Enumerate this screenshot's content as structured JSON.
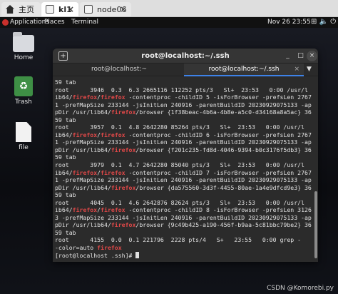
{
  "browser_tabs": [
    {
      "label": "主页",
      "icon": "home-icon"
    },
    {
      "label": "kl1",
      "icon": "vm-icon"
    },
    {
      "label": "node06",
      "icon": "vm-icon"
    }
  ],
  "topbar": {
    "applications": "Applications",
    "places": "Places",
    "terminal": "Terminal",
    "clock": "Nov 26  23:55",
    "status": "⊞ 🔈 ⏻"
  },
  "desktop_icons": [
    {
      "label": "Home",
      "icon": "folder-icon"
    },
    {
      "label": "Trash",
      "icon": "trash-icon"
    },
    {
      "label": "file",
      "icon": "file-icon"
    }
  ],
  "terminal": {
    "title": "root@localhost:~/.ssh",
    "tabs": [
      {
        "label": "root@localhost:~"
      },
      {
        "label": "root@localhost:~/.ssh"
      }
    ],
    "highlight_color": "#e04848",
    "lines": [
      [
        [
          "59 tab",
          ""
        ]
      ],
      [
        [
          "root      3946  0.3  6.3 2665116 112252 pts/3   Sl+  23:53   0:00 /usr/l",
          ""
        ]
      ],
      [
        [
          "ib64/",
          ""
        ],
        [
          "firefox",
          "hl"
        ],
        [
          "/",
          ""
        ],
        [
          "firefox",
          "hl"
        ],
        [
          " -contentproc -childID 5 -isForBrowser -prefsLen 2767",
          ""
        ]
      ],
      [
        [
          "1 -prefMapSize 233144 -jsInitLen 240916 -parentBuildID 20230929075133 -ap",
          ""
        ]
      ],
      [
        [
          "pDir /usr/lib64/",
          ""
        ],
        [
          "firefox",
          "hl"
        ],
        [
          "/browser {1f38beac-4b6a-4b8e-a5c0-d34168a8a5ac} 36",
          ""
        ]
      ],
      [
        [
          "59 tab",
          ""
        ]
      ],
      [
        [
          "root      3957  0.1  4.8 2642280 85264 pts/3   Sl+  23:53   0:00 /usr/l",
          ""
        ]
      ],
      [
        [
          "ib64/",
          ""
        ],
        [
          "firefox",
          "hl"
        ],
        [
          "/",
          ""
        ],
        [
          "firefox",
          "hl"
        ],
        [
          " -contentproc -childID 6 -isForBrowser -prefsLen 2767",
          ""
        ]
      ],
      [
        [
          "1 -prefMapSize 233144 -jsInitLen 240916 -parentBuildID 20230929075133 -ap",
          ""
        ]
      ],
      [
        [
          "pDir /usr/lib64/",
          ""
        ],
        [
          "firefox",
          "hl"
        ],
        [
          "/browser {f201c235-fd8d-4046-9394-b0c3176f5db3} 36",
          ""
        ]
      ],
      [
        [
          "59 tab",
          ""
        ]
      ],
      [
        [
          "root      3979  0.1  4.7 2642280 85040 pts/3   Sl+  23:53   0:00 /usr/l",
          ""
        ]
      ],
      [
        [
          "ib64/",
          ""
        ],
        [
          "firefox",
          "hl"
        ],
        [
          "/",
          ""
        ],
        [
          "firefox",
          "hl"
        ],
        [
          " -contentproc -childID 7 -isForBrowser -prefsLen 2767",
          ""
        ]
      ],
      [
        [
          "1 -prefMapSize 233144 -jsInitLen 240916 -parentBuildID 20230929075133 -ap",
          ""
        ]
      ],
      [
        [
          "pDir /usr/lib64/",
          ""
        ],
        [
          "firefox",
          "hl"
        ],
        [
          "/browser {da575560-3d3f-4455-80ae-1a4e9dfcd9e3} 36",
          ""
        ]
      ],
      [
        [
          "59 tab",
          ""
        ]
      ],
      [
        [
          "root      4045  0.1  4.6 2642876 82624 pts/3   Sl+  23:53   0:00 /usr/l",
          ""
        ]
      ],
      [
        [
          "ib64/",
          ""
        ],
        [
          "firefox",
          "hl"
        ],
        [
          "/",
          ""
        ],
        [
          "firefox",
          "hl"
        ],
        [
          " -contentproc -childID 8 -isForBrowser -prefsLen 3126",
          ""
        ]
      ],
      [
        [
          "3 -prefMapSize 233144 -jsInitLen 240916 -parentBuildID 20230929075133 -ap",
          ""
        ]
      ],
      [
        [
          "pDir /usr/lib64/",
          ""
        ],
        [
          "firefox",
          "hl"
        ],
        [
          "/browser {9c49b425-a190-456f-b9aa-5c81bbc79be2} 36",
          ""
        ]
      ],
      [
        [
          "59 tab",
          ""
        ]
      ],
      [
        [
          "root      4155  0.0  0.1 221796  2228 pts/4   S+   23:55   0:00 grep -",
          ""
        ]
      ],
      [
        [
          "-color=auto ",
          ""
        ],
        [
          "firefox",
          "hl"
        ]
      ],
      [
        [
          "[root@localhost .ssh]# ",
          ""
        ]
      ]
    ]
  },
  "watermark": "CSDN @Komorebi.py"
}
